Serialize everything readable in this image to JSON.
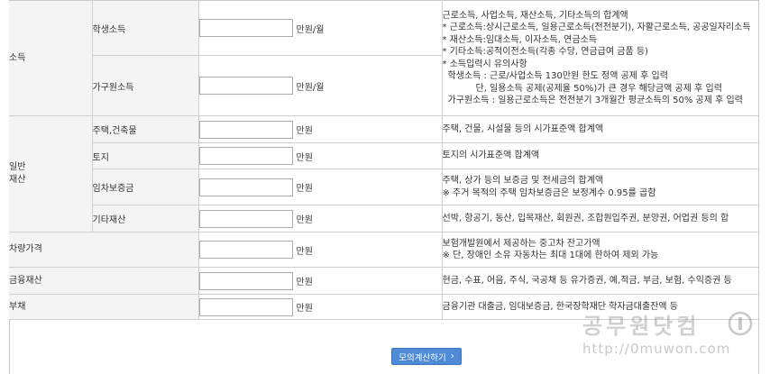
{
  "rows": {
    "income": {
      "category": "소득",
      "student": {
        "label": "학생소득",
        "value": "",
        "unit": "만원/월"
      },
      "household": {
        "label": "가구원소득",
        "value": "",
        "unit": "만원/월"
      },
      "desc": [
        "근로소득, 사업소득, 재산소득, 기타소득의 합계액",
        "* 근로소득:상시근로소득, 일용근로소득(전전분기), 자활근로소득, 공공일자리소득",
        "* 재산소득:임대소득, 이자소득, 연금소득",
        "* 기타소득:공적이전소득(각종 수당, 연금급여 금품 등)",
        "* 소득입력시 유의사항",
        "학생소득 : 근로/사업소득 130만원 한도 정액 공제 후 입력",
        "단, 일용소득 공제(공제율 50%)가 큰 경우 해당금액 공제 후 입력",
        "가구원소득 : 일용근로소득은 전전분기 3개월간 평균소득의 50% 공제 후 입력"
      ]
    },
    "general_property": {
      "category_line1": "일반",
      "category_line2": "재산",
      "items": [
        {
          "label": "주택,건축물",
          "value": "",
          "unit": "만원",
          "desc": [
            "주택, 건물, 시설물 등의 시가표준액 합계액"
          ]
        },
        {
          "label": "토지",
          "value": "",
          "unit": "만원",
          "desc": [
            "토지의 시가표준액 합계액"
          ]
        },
        {
          "label": "임차보증금",
          "value": "",
          "unit": "만원",
          "desc": [
            "주택, 상가 등의 보증금 및 전세금의 합계액",
            "※ 주거 목적의 주택 임차보증금은 보정계수 0.95를 곱함"
          ]
        },
        {
          "label": "기타재산",
          "value": "",
          "unit": "만원",
          "desc": [
            "선박, 항공기, 동산, 입목재산, 회원권, 조합원입주권, 분양권, 어업권 등의 합"
          ]
        }
      ]
    },
    "vehicle": {
      "category": "차량가격",
      "value": "",
      "unit": "만원",
      "desc": [
        "보험개발원에서 제공하는 중고차 잔고가액",
        "※ 단, 장애인 소유 자동차는 최대 1대에 한하여 제외 가능"
      ]
    },
    "financial": {
      "category": "금융재산",
      "value": "",
      "unit": "만원",
      "desc": [
        "현금, 수표, 어음, 주식, 국공채 등 유가증권, 예,적금, 부금, 보험, 수익증권 등"
      ]
    },
    "debt": {
      "category": "부채",
      "value": "",
      "unit": "만원",
      "desc": [
        "금융기관 대출금, 임대보증금, 한국장학재단 학자금대출잔액 등"
      ]
    }
  },
  "button": {
    "label": "모의계산하기",
    "icon": "chevron-right-icon"
  },
  "watermark": {
    "logo_text": "공무원닷컴",
    "url": "http://0muwon.com"
  },
  "colors": {
    "header_bg": "#f4f4f4",
    "border": "#cfcfcf",
    "button": "#4f8bd6"
  }
}
